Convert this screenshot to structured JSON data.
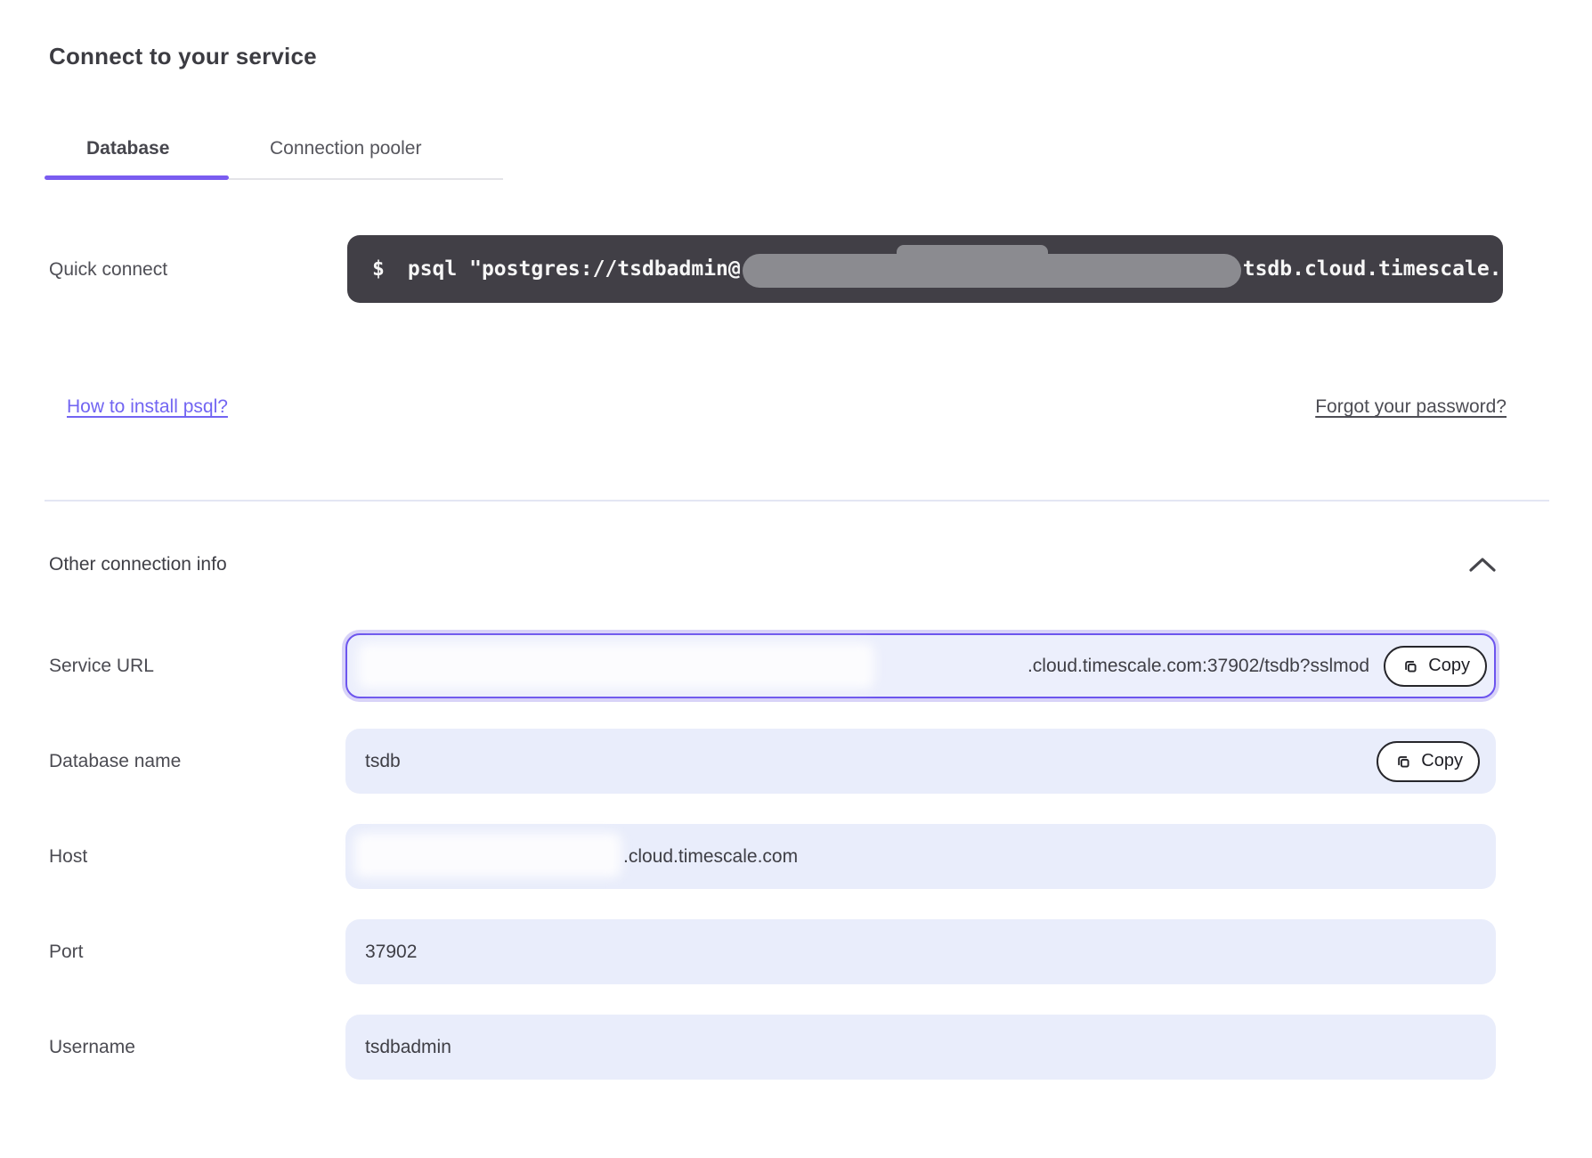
{
  "panel": {
    "title": "Connect to your service"
  },
  "tabs": {
    "database": "Database",
    "connection_pooler": "Connection pooler"
  },
  "quick_connect": {
    "label": "Quick connect",
    "prompt": "$",
    "command_prefix": "psql \"postgres://tsdbadmin@",
    "command_redacted": true,
    "command_suffix": "tsdb.cloud.timescale."
  },
  "links": {
    "install_psql": "How to install psql?",
    "forgot_password": "Forgot your password?"
  },
  "section": {
    "heading": "Other connection info"
  },
  "copy_label": "Copy",
  "fields": [
    {
      "label": "Service URL",
      "value": ".cloud.timescale.com:37902/tsdb?sslmod",
      "redacted": true,
      "has_copy": true,
      "focused": true
    },
    {
      "label": "Database name",
      "value": "tsdb",
      "redacted": false,
      "has_copy": true,
      "focused": false
    },
    {
      "label": "Host",
      "value": ".cloud.timescale.com",
      "redacted": true,
      "has_copy": false,
      "focused": false
    },
    {
      "label": "Port",
      "value": "37902",
      "redacted": false,
      "has_copy": false,
      "focused": false
    },
    {
      "label": "Username",
      "value": "tsdbadmin",
      "redacted": false,
      "has_copy": false,
      "focused": false
    }
  ],
  "icons": {
    "chevron_up": "chevron-up",
    "copy": "copy-duplicate-squares"
  },
  "colors": {
    "accent_purple": "#6c55ee",
    "tab_underline_purple": "#7a5cf0",
    "link_purple": "#7265f2",
    "code_background": "#413f46",
    "code_text": "#f6f6f6",
    "redaction_gray": "#8b8b90",
    "field_background": "#e9edfb",
    "focus_glow": "#d8d3f8",
    "text_dark": "#3c3c42",
    "text_muted": "#4f4f56",
    "divider": "#e3e6f3"
  }
}
